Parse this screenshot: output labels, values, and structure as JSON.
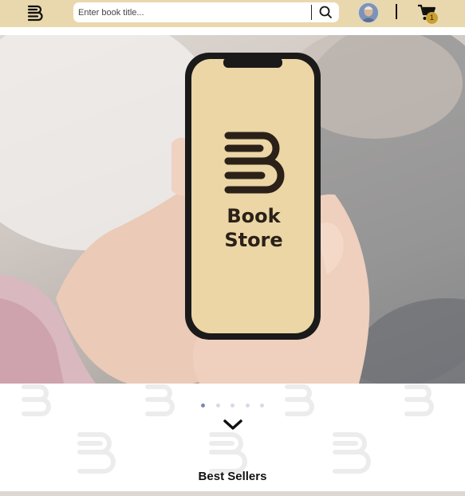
{
  "header": {
    "search": {
      "placeholder": "Enter book title...",
      "value": ""
    },
    "cart": {
      "count": "1"
    }
  },
  "hero": {
    "logo_text_line1": "Book",
    "logo_text_line2": "Store"
  },
  "carousel": {
    "slides": 5,
    "active_index": 0
  },
  "sections": {
    "best_sellers_title": "Best Sellers"
  },
  "colors": {
    "header_bg": "#e9d8ad",
    "accent_gold": "#c9a033",
    "phone_screen": "#ecd6a6",
    "dot_active": "#7a86b8",
    "dot_inactive": "#d7dae6"
  },
  "icons": [
    "book-stack-logo-icon",
    "search-icon",
    "user-avatar",
    "cart-icon",
    "chevron-down-icon"
  ]
}
